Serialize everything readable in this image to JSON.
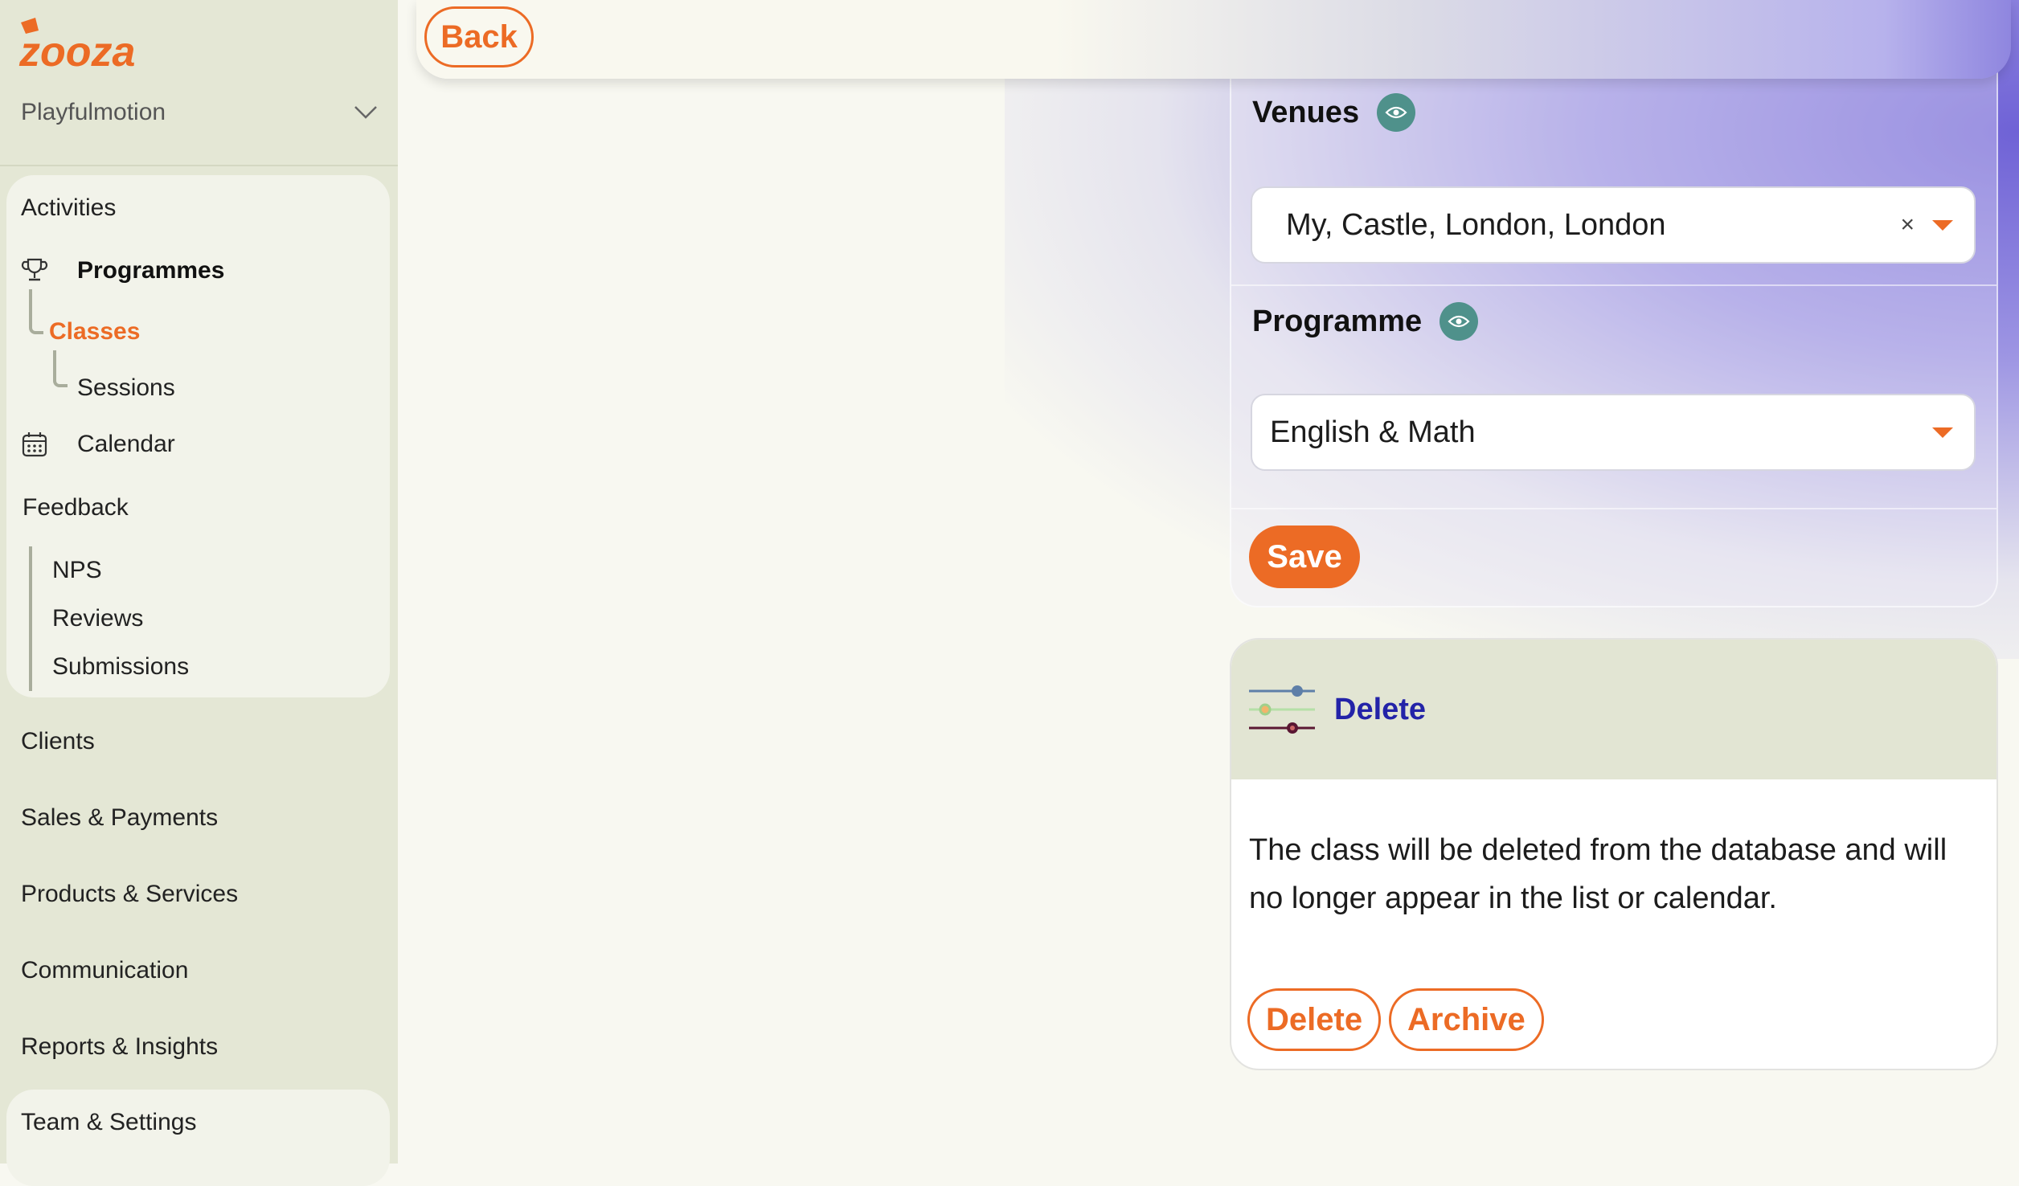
{
  "brand": {
    "logo_text": "zooza",
    "accent_color": "#ec6b25",
    "sidebar_bg": "#e4e7d5",
    "link_color": "#2323a8",
    "eye_color": "#4f918b"
  },
  "sidebar": {
    "organization": "Playfulmotion",
    "activities_heading": "Activities",
    "programmes": "Programmes",
    "classes": "Classes",
    "sessions": "Sessions",
    "calendar": "Calendar",
    "feedback_heading": "Feedback",
    "feedback_items": [
      "NPS",
      "Reviews",
      "Submissions"
    ],
    "sections": [
      "Clients",
      "Sales & Payments",
      "Products & Services",
      "Communication",
      "Reports & Insights"
    ],
    "team_settings": "Team & Settings"
  },
  "topbar": {
    "back_label": "Back"
  },
  "form": {
    "venues_label": "Venues",
    "venues_value": "My, Castle, London, London",
    "clear_symbol": "×",
    "programme_label": "Programme",
    "programme_value": "English & Math",
    "save_label": "Save"
  },
  "delete_card": {
    "title": "Delete",
    "description": "The class will be deleted from the database and will no longer appear in the list or calendar.",
    "delete_label": "Delete",
    "archive_label": "Archive"
  }
}
